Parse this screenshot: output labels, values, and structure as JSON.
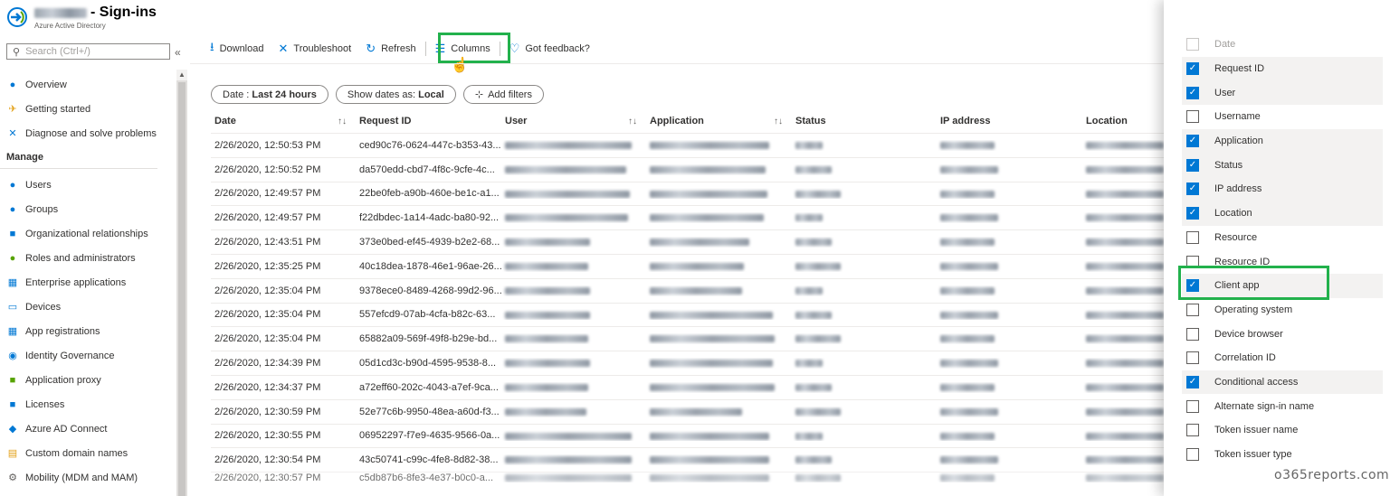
{
  "header": {
    "title": "- Sign-ins",
    "subtitle": "Azure Active Directory"
  },
  "sidebar": {
    "search_placeholder": "Search (Ctrl+/)",
    "collapse_icon": "«",
    "items_top": [
      {
        "label": "Overview",
        "icon": "info-icon",
        "glyph": "●",
        "color": "#0078d4"
      },
      {
        "label": "Getting started",
        "icon": "rocket-icon",
        "glyph": "✈",
        "color": "#e3a21a"
      },
      {
        "label": "Diagnose and solve problems",
        "icon": "wrench-icon",
        "glyph": "✕",
        "color": "#0078d4"
      }
    ],
    "section_manage": "Manage",
    "items_manage": [
      {
        "label": "Users",
        "icon": "user-icon",
        "glyph": "●",
        "color": "#0078d4"
      },
      {
        "label": "Groups",
        "icon": "groups-icon",
        "glyph": "●",
        "color": "#0078d4"
      },
      {
        "label": "Organizational relationships",
        "icon": "org-icon",
        "glyph": "■",
        "color": "#0078d4"
      },
      {
        "label": "Roles and administrators",
        "icon": "roles-icon",
        "glyph": "●",
        "color": "#57a300"
      },
      {
        "label": "Enterprise applications",
        "icon": "enterprise-apps-icon",
        "glyph": "▦",
        "color": "#0078d4"
      },
      {
        "label": "Devices",
        "icon": "devices-icon",
        "glyph": "▭",
        "color": "#0078d4"
      },
      {
        "label": "App registrations",
        "icon": "app-registrations-icon",
        "glyph": "▦",
        "color": "#0078d4"
      },
      {
        "label": "Identity Governance",
        "icon": "identity-governance-icon",
        "glyph": "◉",
        "color": "#0078d4"
      },
      {
        "label": "Application proxy",
        "icon": "app-proxy-icon",
        "glyph": "■",
        "color": "#57a300"
      },
      {
        "label": "Licenses",
        "icon": "licenses-icon",
        "glyph": "■",
        "color": "#0078d4"
      },
      {
        "label": "Azure AD Connect",
        "icon": "ad-connect-icon",
        "glyph": "◆",
        "color": "#0078d4"
      },
      {
        "label": "Custom domain names",
        "icon": "domain-icon",
        "glyph": "▤",
        "color": "#e3a21a"
      },
      {
        "label": "Mobility (MDM and MAM)",
        "icon": "mobility-icon",
        "glyph": "⚙",
        "color": "#605e5c"
      }
    ]
  },
  "toolbar": {
    "download": "Download",
    "troubleshoot": "Troubleshoot",
    "refresh": "Refresh",
    "columns": "Columns",
    "feedback": "Got feedback?"
  },
  "filters": {
    "date_prefix": "Date :",
    "date_value": "Last 24 hours",
    "show_dates_prefix": "Show dates as:",
    "show_dates_value": "Local",
    "add_filters": "Add filters"
  },
  "table": {
    "headers": [
      "Date",
      "Request ID",
      "User",
      "Application",
      "Status",
      "IP address",
      "Location"
    ],
    "rows": [
      {
        "date": "2/26/2020, 12:50:53 PM",
        "request_id": "ced90c76-0624-447c-b353-43..."
      },
      {
        "date": "2/26/2020, 12:50:52 PM",
        "request_id": "da570edd-cbd7-4f8c-9cfe-4c..."
      },
      {
        "date": "2/26/2020, 12:49:57 PM",
        "request_id": "22be0feb-a90b-460e-be1c-a1..."
      },
      {
        "date": "2/26/2020, 12:49:57 PM",
        "request_id": "f22dbdec-1a14-4adc-ba80-92..."
      },
      {
        "date": "2/26/2020, 12:43:51 PM",
        "request_id": "373e0bed-ef45-4939-b2e2-68..."
      },
      {
        "date": "2/26/2020, 12:35:25 PM",
        "request_id": "40c18dea-1878-46e1-96ae-26..."
      },
      {
        "date": "2/26/2020, 12:35:04 PM",
        "request_id": "9378ece0-8489-4268-99d2-96..."
      },
      {
        "date": "2/26/2020, 12:35:04 PM",
        "request_id": "557efcd9-07ab-4cfa-b82c-63..."
      },
      {
        "date": "2/26/2020, 12:35:04 PM",
        "request_id": "65882a09-569f-49f8-b29e-bd..."
      },
      {
        "date": "2/26/2020, 12:34:39 PM",
        "request_id": "05d1cd3c-b90d-4595-9538-8..."
      },
      {
        "date": "2/26/2020, 12:34:37 PM",
        "request_id": "a72eff60-202c-4043-a7ef-9ca..."
      },
      {
        "date": "2/26/2020, 12:30:59 PM",
        "request_id": "52e77c6b-9950-48ea-a60d-f3..."
      },
      {
        "date": "2/26/2020, 12:30:55 PM",
        "request_id": "06952297-f7e9-4635-9566-0a..."
      },
      {
        "date": "2/26/2020, 12:30:54 PM",
        "request_id": "43c50741-c99c-4fe8-8d82-38..."
      },
      {
        "date": "2/26/2020, 12:30:57 PM",
        "request_id": "c5db87b6-8fe3-4e37-b0c0-a..."
      }
    ]
  },
  "columns_panel": {
    "items": [
      {
        "label": "Date",
        "checked": false,
        "disabled": true
      },
      {
        "label": "Request ID",
        "checked": true,
        "disabled": false
      },
      {
        "label": "User",
        "checked": true,
        "disabled": false
      },
      {
        "label": "Username",
        "checked": false,
        "disabled": false
      },
      {
        "label": "Application",
        "checked": true,
        "disabled": false
      },
      {
        "label": "Status",
        "checked": true,
        "disabled": false
      },
      {
        "label": "IP address",
        "checked": true,
        "disabled": false
      },
      {
        "label": "Location",
        "checked": true,
        "disabled": false
      },
      {
        "label": "Resource",
        "checked": false,
        "disabled": false
      },
      {
        "label": "Resource ID",
        "checked": false,
        "disabled": false
      },
      {
        "label": "Client app",
        "checked": true,
        "disabled": false
      },
      {
        "label": "Operating system",
        "checked": false,
        "disabled": false
      },
      {
        "label": "Device browser",
        "checked": false,
        "disabled": false
      },
      {
        "label": "Correlation ID",
        "checked": false,
        "disabled": false
      },
      {
        "label": "Conditional access",
        "checked": true,
        "disabled": false
      },
      {
        "label": "Alternate sign-in name",
        "checked": false,
        "disabled": false
      },
      {
        "label": "Token issuer name",
        "checked": false,
        "disabled": false
      },
      {
        "label": "Token issuer type",
        "checked": false,
        "disabled": false
      }
    ]
  },
  "watermark": "o365reports.com",
  "colors": {
    "accent": "#0078d4",
    "highlight": "#22b14c"
  }
}
